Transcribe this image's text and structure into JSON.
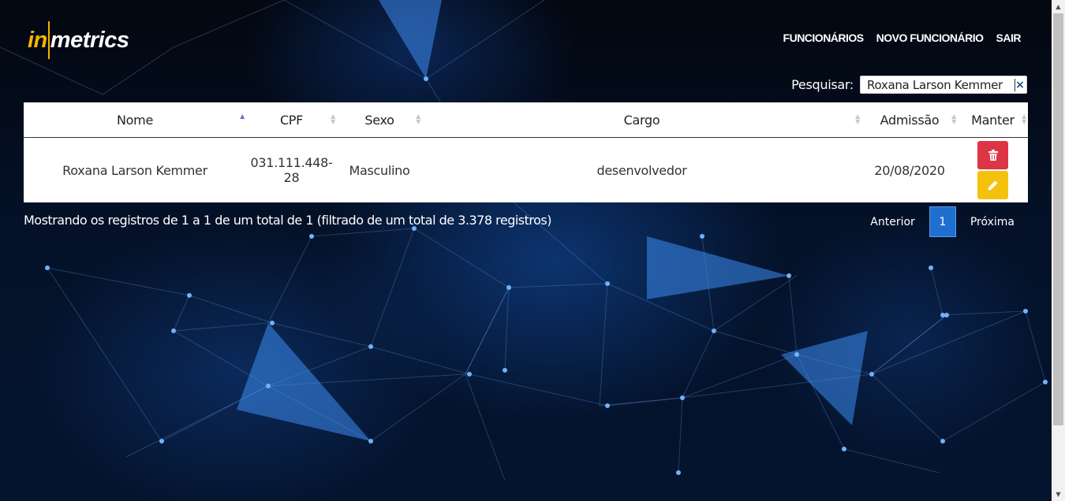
{
  "brand": {
    "logo_in": "in",
    "logo_metrics": "metrics",
    "accent_color": "#f4b400"
  },
  "nav": {
    "items": [
      {
        "label": "FUNCIONÁRIOS"
      },
      {
        "label": "NOVO FUNCIONÁRIO"
      },
      {
        "label": "SAIR"
      }
    ]
  },
  "search": {
    "label": "Pesquisar:",
    "value": "Roxana Larson Kemmer",
    "clear_icon": "×"
  },
  "table": {
    "columns": [
      {
        "label": "Nome",
        "sorted": "asc"
      },
      {
        "label": "CPF"
      },
      {
        "label": "Sexo"
      },
      {
        "label": "Cargo"
      },
      {
        "label": "Admissão"
      },
      {
        "label": "Manter"
      }
    ],
    "rows": [
      {
        "nome": "Roxana Larson Kemmer",
        "cpf": "031.111.448-28",
        "sexo": "Masculino",
        "cargo": "desenvolvedor",
        "admissao": "20/08/2020",
        "actions": [
          {
            "icon": "trash-icon",
            "color": "#dc3545"
          },
          {
            "icon": "pencil-icon",
            "color": "#f4c20d"
          }
        ]
      }
    ]
  },
  "info": {
    "text": "Mostrando os registros de 1 a 1 de um total de 1 (filtrado de um total de 3.378 registros)"
  },
  "pagination": {
    "previous_label": "Anterior",
    "current_page": "1",
    "next_label": "Próxima",
    "active_color": "#1f6fd0"
  }
}
